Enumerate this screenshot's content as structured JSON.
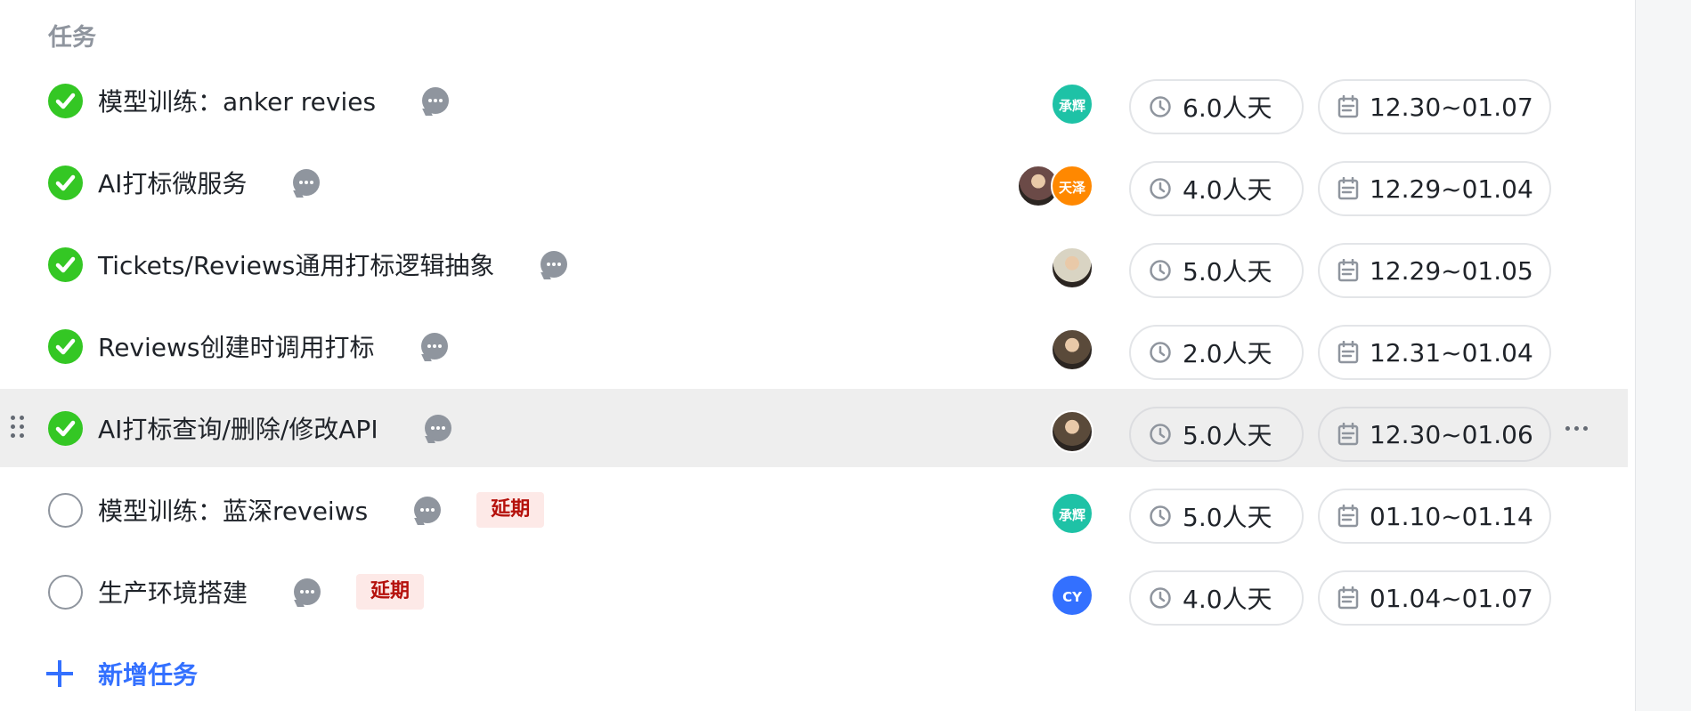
{
  "section": {
    "title": "任务"
  },
  "tasks": [
    {
      "title": "模型训练：anker revies",
      "done": true,
      "tag": "",
      "assignees": [
        {
          "label": "承辉",
          "color": "#1ec2a6"
        }
      ],
      "effort": "6.0人天",
      "dates": "12.30~01.07",
      "hover": false
    },
    {
      "title": "AI打标微服务",
      "done": true,
      "tag": "",
      "assignees": [
        {
          "label": "",
          "color": "#6b4a47",
          "photo": true
        },
        {
          "label": "天泽",
          "color": "#ff8800"
        }
      ],
      "effort": "4.0人天",
      "dates": "12.29~01.04",
      "hover": false
    },
    {
      "title": "Tickets/Reviews通用打标逻辑抽象",
      "done": true,
      "tag": "",
      "assignees": [
        {
          "label": "",
          "color": "#d9d4c3",
          "photo": true
        }
      ],
      "effort": "5.0人天",
      "dates": "12.29~01.05",
      "hover": false
    },
    {
      "title": "Reviews创建时调用打标",
      "done": true,
      "tag": "",
      "assignees": [
        {
          "label": "",
          "color": "#5a4a3a",
          "photo": true
        }
      ],
      "effort": "2.0人天",
      "dates": "12.31~01.04",
      "hover": false
    },
    {
      "title": "AI打标查询/删除/修改API",
      "done": true,
      "tag": "",
      "assignees": [
        {
          "label": "",
          "color": "#5a4a3a",
          "photo": true
        }
      ],
      "effort": "5.0人天",
      "dates": "12.30~01.06",
      "hover": true
    },
    {
      "title": "模型训练：蓝深reveiws",
      "done": false,
      "tag": "延期",
      "assignees": [
        {
          "label": "承辉",
          "color": "#1ec2a6"
        }
      ],
      "effort": "5.0人天",
      "dates": "01.10~01.14",
      "hover": false
    },
    {
      "title": "生产环境搭建",
      "done": false,
      "tag": "延期",
      "assignees": [
        {
          "label": "CY",
          "color": "#3370ff"
        }
      ],
      "effort": "4.0人天",
      "dates": "01.04~01.07",
      "hover": false
    }
  ],
  "icons": {
    "status_done": "check-circle-icon",
    "status_todo": "empty-circle-icon",
    "comment": "comment-bubble-icon",
    "effort": "clock-icon",
    "dates": "calendar-icon",
    "more": "more-horizontal-icon",
    "drag": "drag-handle-icon",
    "add": "plus-icon"
  },
  "add_task": {
    "label": "新增任务"
  },
  "colors": {
    "done": "#34c724",
    "accent": "#3370ff",
    "tag_bg": "#fde9e7",
    "tag_text": "#b5110c",
    "hover_row": "#eeeeee"
  }
}
